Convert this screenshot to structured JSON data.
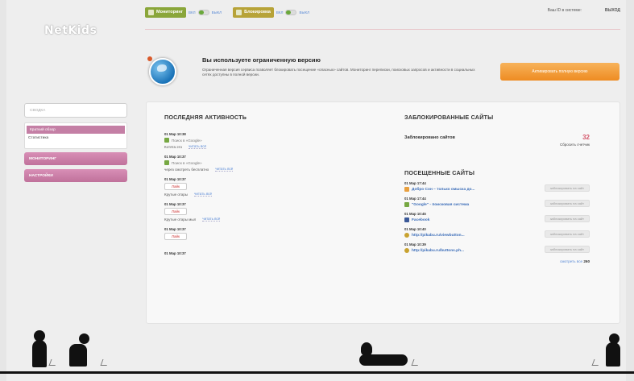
{
  "logo": "NetKids",
  "topbar": {
    "monitoring_label": "Мониторинг",
    "blocking_label": "Блокировка",
    "switch_on": "ВКЛ",
    "switch_off": "ВЫКЛ",
    "user_id_label": "Ваш ID в системе:",
    "logout_label": "ВЫХОД"
  },
  "banner": {
    "title": "Вы используете ограниченную версию",
    "text": "Ограниченная версия сервиса позволяет блокировать посещение «опасных» сайтов. Мониторинг переписки, поисковых запросов и активности в социальных сетях доступны в полной версии.",
    "cta": "Активировать полную версию"
  },
  "sidebar": {
    "search_placeholder": "СВОДКА",
    "sub_items": [
      "Краткий обзор",
      "Статистика"
    ],
    "main_items": [
      "МОНИТОРИНГ",
      "НАСТРОЙКИ"
    ]
  },
  "recent": {
    "title": "ПОСЛЕДНЯЯ АКТИВНОСТЬ",
    "more_label": "читать всё",
    "items": [
      {
        "date": "01 Мар 10:38",
        "source": "Поиск в «Google»",
        "query": "Котята это"
      },
      {
        "date": "01 Мар 10:37",
        "source": "Поиск в «Google»",
        "query": "через смотреть бесплатно"
      },
      {
        "date": "01 Мар 10:37",
        "tag": "Лайк",
        "query": "Крутые отары"
      },
      {
        "date": "01 Мар 10:37",
        "tag": "Лайк",
        "query": "Крутые отары мыл"
      },
      {
        "date": "01 Мар 10:37",
        "tag": "Лайк"
      }
    ],
    "last_date": "01 Мар 10:37"
  },
  "blocked": {
    "title": "ЗАБЛОКИРОВАННЫЕ САЙТЫ",
    "row_label": "Заблокировано сайтов",
    "count": "32",
    "reset_label": "Сбросить счетчик"
  },
  "visited": {
    "title": "ПОСЕЩЕННЫЕ САЙТЫ",
    "block_label": "заблокировать на сайт",
    "items": [
      {
        "date": "01 Мар 17:44",
        "title": "Добро Сон – только омыска до..."
      },
      {
        "date": "01 Мар 17:44",
        "title": "\"Google\" - поисковая система"
      },
      {
        "date": "01 Мар 10:45",
        "title": "Facebook"
      },
      {
        "date": "01 Мар 10:40",
        "title": "http://pikabu.ru/viewbutton..."
      },
      {
        "date": "01 Мар 10:39",
        "title": "http://pikabu.ru/buttons.ph..."
      }
    ],
    "view_all_label": "смотреть все",
    "view_all_count": "260"
  }
}
